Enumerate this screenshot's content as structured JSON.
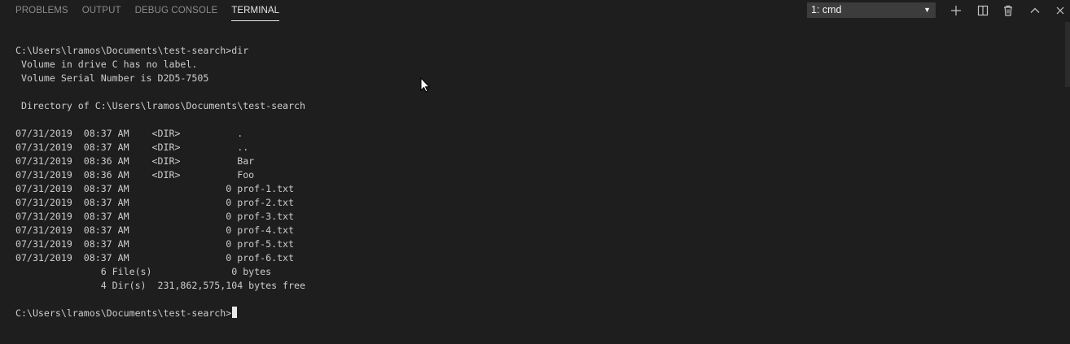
{
  "tabs": [
    {
      "label": "PROBLEMS"
    },
    {
      "label": "OUTPUT"
    },
    {
      "label": "DEBUG CONSOLE"
    },
    {
      "label": "TERMINAL",
      "active": true
    }
  ],
  "terminal_selector": {
    "value": "1: cmd",
    "arrow": "▼"
  },
  "actions": {
    "new_terminal": "plus-icon",
    "split_terminal": "split-icon",
    "kill_terminal": "trash-icon",
    "maximize_panel": "chevron-up-icon",
    "close_panel": "close-icon"
  },
  "terminal": {
    "lines": [
      "C:\\Users\\lramos\\Documents\\test-search>dir",
      " Volume in drive C has no label.",
      " Volume Serial Number is D2D5-7505",
      "",
      " Directory of C:\\Users\\lramos\\Documents\\test-search",
      "",
      "07/31/2019  08:37 AM    <DIR>          .",
      "07/31/2019  08:37 AM    <DIR>          ..",
      "07/31/2019  08:36 AM    <DIR>          Bar",
      "07/31/2019  08:36 AM    <DIR>          Foo",
      "07/31/2019  08:37 AM                 0 prof-1.txt",
      "07/31/2019  08:37 AM                 0 prof-2.txt",
      "07/31/2019  08:37 AM                 0 prof-3.txt",
      "07/31/2019  08:37 AM                 0 prof-4.txt",
      "07/31/2019  08:37 AM                 0 prof-5.txt",
      "07/31/2019  08:37 AM                 0 prof-6.txt",
      "               6 File(s)              0 bytes",
      "               4 Dir(s)  231,862,575,104 bytes free",
      ""
    ],
    "prompt": "C:\\Users\\lramos\\Documents\\test-search>"
  },
  "colors": {
    "background": "#1e1e1e",
    "text": "#cccccc",
    "tab_inactive": "#8b8b8b",
    "tab_active": "#e7e7e7",
    "select_bg": "#3c3c3c"
  }
}
